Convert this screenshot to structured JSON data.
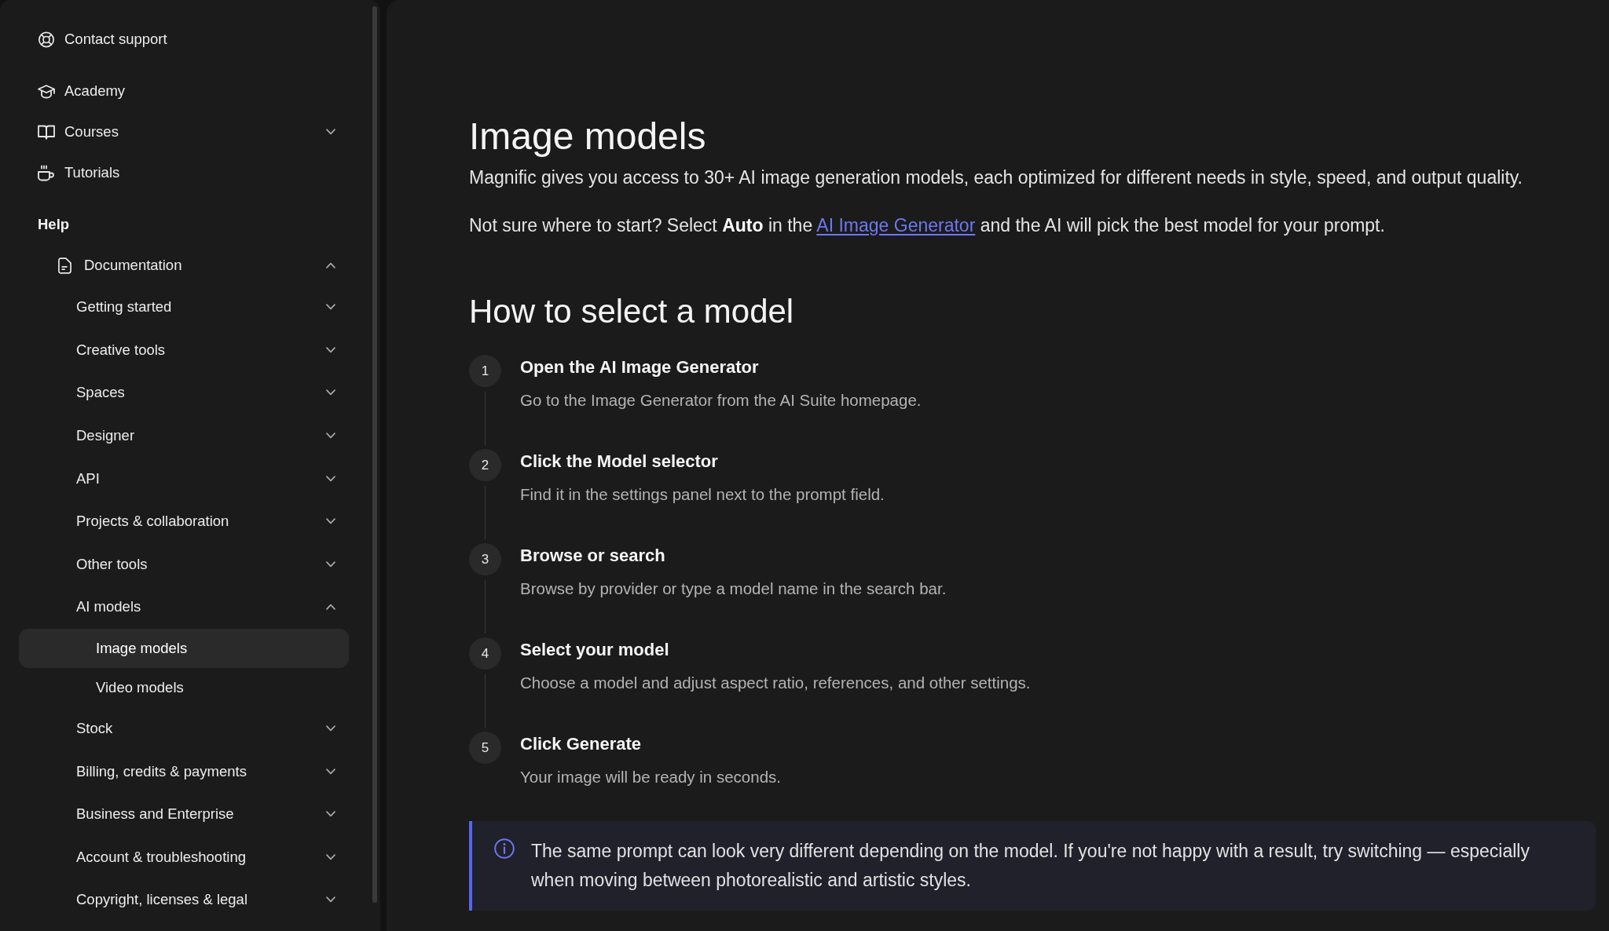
{
  "sidebar": {
    "link_groups": [
      {
        "items": [
          {
            "kind": "support",
            "label": "Contact support",
            "selected": false
          }
        ]
      },
      {
        "items": [
          {
            "kind": "academy",
            "label": "Academy",
            "selected": false
          },
          {
            "kind": "courses",
            "label": "Courses",
            "selected": false,
            "expanded": false
          },
          {
            "kind": "tutorials",
            "label": "Tutorials",
            "selected": false
          }
        ]
      }
    ],
    "section_title": "Help",
    "tree": [
      {
        "kind": "document",
        "label": "Documentation",
        "selected": false,
        "expanded": true,
        "children": [
          {
            "label": "Getting started",
            "selected": false,
            "expanded": false
          },
          {
            "label": "Creative tools",
            "selected": false,
            "expanded": false
          },
          {
            "label": "Spaces",
            "selected": false,
            "expanded": false
          },
          {
            "label": "Designer",
            "selected": false,
            "expanded": false
          },
          {
            "label": "API",
            "selected": false,
            "expanded": false
          },
          {
            "label": "Projects & collaboration",
            "selected": false,
            "expanded": false
          },
          {
            "label": "Other tools",
            "selected": false,
            "expanded": false
          },
          {
            "label": "AI models",
            "selected": false,
            "expanded": true,
            "children": [
              {
                "label": "Image models",
                "selected": true
              },
              {
                "label": "Video models",
                "selected": false
              }
            ]
          },
          {
            "label": "Stock",
            "selected": false,
            "expanded": false
          },
          {
            "label": "Billing, credits & payments",
            "selected": false,
            "expanded": false
          },
          {
            "label": "Business and Enterprise",
            "selected": false,
            "expanded": false
          },
          {
            "label": "Account & troubleshooting",
            "selected": false,
            "expanded": false
          },
          {
            "label": "Copyright, licenses & legal",
            "selected": false,
            "expanded": false
          }
        ]
      }
    ]
  },
  "article": {
    "title": "Image models",
    "intro": "Magnific gives you access to 30+ AI image generation models, each optimized for different needs in style, speed, and output quality.",
    "hint": {
      "text_before": "Not sure where to start? Select **Auto** in the ",
      "link": "AI Image Generator",
      "text_after": " and the AI will pick the best model for your prompt."
    },
    "section_title": "How to select a model",
    "steps": [
      {
        "number": "1",
        "title": "Open the AI Image Generator",
        "description": "Go to the Image Generator from the AI Suite homepage."
      },
      {
        "number": "2",
        "title": "Click the Model selector",
        "description": "Find it in the settings panel next to the prompt field."
      },
      {
        "number": "3",
        "title": "Browse or search",
        "description": "Browse by provider or type a model name in the search bar."
      },
      {
        "number": "4",
        "title": "Select your model",
        "description": "Choose a model and adjust aspect ratio, references, and other settings."
      },
      {
        "number": "5",
        "title": "Click Generate",
        "description": "Your image will be ready in seconds."
      }
    ],
    "callout": {
      "kind": "info",
      "text": "The same prompt can look very different depending on the model. If you're not happy with a result, try switching — especially when moving between photorealistic and artistic styles."
    }
  }
}
